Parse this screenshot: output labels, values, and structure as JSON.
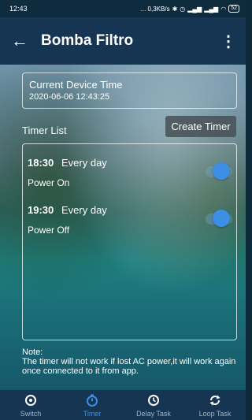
{
  "status_bar": {
    "time": "12:43",
    "network_speed": "... 0,3KB/s",
    "battery": "52"
  },
  "app_bar": {
    "title": "Bomba Filtro",
    "back_icon": "back-arrow-icon",
    "menu_icon": "overflow-menu-icon"
  },
  "device_time": {
    "label": "Current Device Time",
    "value": "2020-06-06 12:43:25"
  },
  "timer_list": {
    "label": "Timer List",
    "create_button": "Create Timer",
    "items": [
      {
        "time": "18:30",
        "repeat": "Every day",
        "action": "Power On",
        "enabled": true
      },
      {
        "time": "19:30",
        "repeat": "Every day",
        "action": "Power Off",
        "enabled": true
      }
    ]
  },
  "note": {
    "title": "Note:",
    "text": "The timer will not work if lost AC power,it will work again once connected to it from app."
  },
  "bottom_nav": {
    "items": [
      {
        "label": "Switch",
        "icon": "power-icon",
        "active": false
      },
      {
        "label": "Timer",
        "icon": "stopwatch-icon",
        "active": true
      },
      {
        "label": "Delay Task",
        "icon": "clock-icon",
        "active": false
      },
      {
        "label": "Loop Task",
        "icon": "loop-icon",
        "active": false
      }
    ]
  },
  "colors": {
    "accent": "#3d8fe6",
    "app_bar": "#163553",
    "status_bar": "#0f2c3f"
  }
}
